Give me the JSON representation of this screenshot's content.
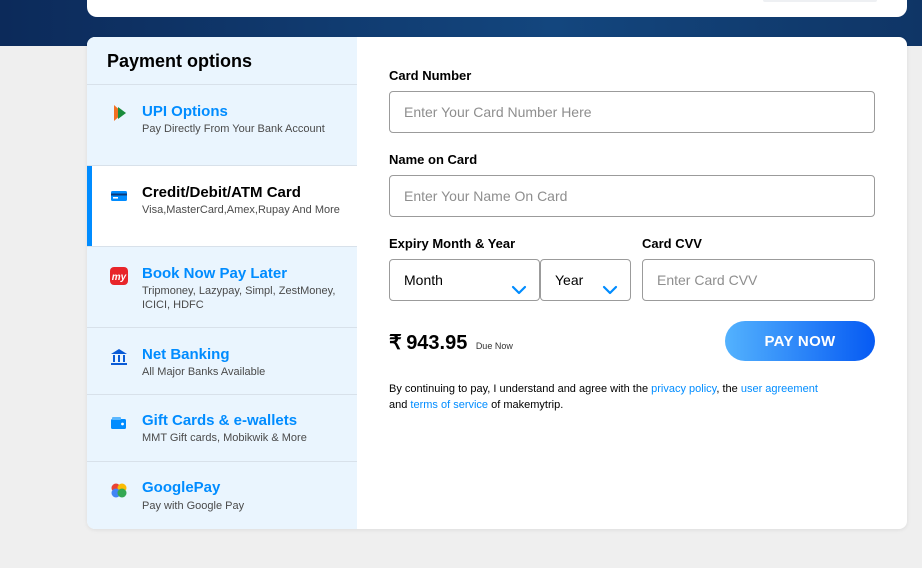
{
  "sidebar": {
    "title": "Payment options",
    "options": [
      {
        "title": "UPI Options",
        "subtitle": "Pay Directly From Your Bank Account",
        "icon": "upi-icon"
      },
      {
        "title": "Credit/Debit/ATM Card",
        "subtitle": "Visa,MasterCard,Amex,Rupay And More",
        "icon": "credit-card-icon"
      },
      {
        "title": "Book Now Pay Later",
        "subtitle": "Tripmoney, Lazypay, Simpl, ZestMoney, ICICI, HDFC",
        "icon": "mmt-logo-icon"
      },
      {
        "title": "Net Banking",
        "subtitle": "All Major Banks Available",
        "icon": "bank-icon"
      },
      {
        "title": "Gift Cards & e-wallets",
        "subtitle": "MMT Gift cards, Mobikwik & More",
        "icon": "wallet-icon"
      },
      {
        "title": "GooglePay",
        "subtitle": "Pay with Google Pay",
        "icon": "google-pay-icon"
      }
    ]
  },
  "form": {
    "card_number_label": "Card Number",
    "card_number_placeholder": "Enter Your Card Number Here",
    "name_label": "Name on Card",
    "name_placeholder": "Enter Your Name On Card",
    "expiry_label": "Expiry Month & Year",
    "month_value": "Month",
    "year_value": "Year",
    "cvv_label": "Card CVV",
    "cvv_placeholder": "Enter Card CVV"
  },
  "payment": {
    "currency_symbol": "₹",
    "amount": "943.95",
    "due_label": "Due Now",
    "pay_button": "PAY NOW"
  },
  "terms": {
    "prefix": "By continuing to pay, I understand and agree with the ",
    "privacy_link": "privacy policy",
    "middle": ", the ",
    "agreement_link": "user agreement",
    "and": " and ",
    "terms_link": "terms of service",
    "suffix": " of makemytrip."
  },
  "colors": {
    "accent": "#008cff",
    "sidebar_bg": "#eaf5fe",
    "header_band": "#13467e",
    "pay_gradient_start": "#53b2fe",
    "pay_gradient_end": "#065af3"
  }
}
